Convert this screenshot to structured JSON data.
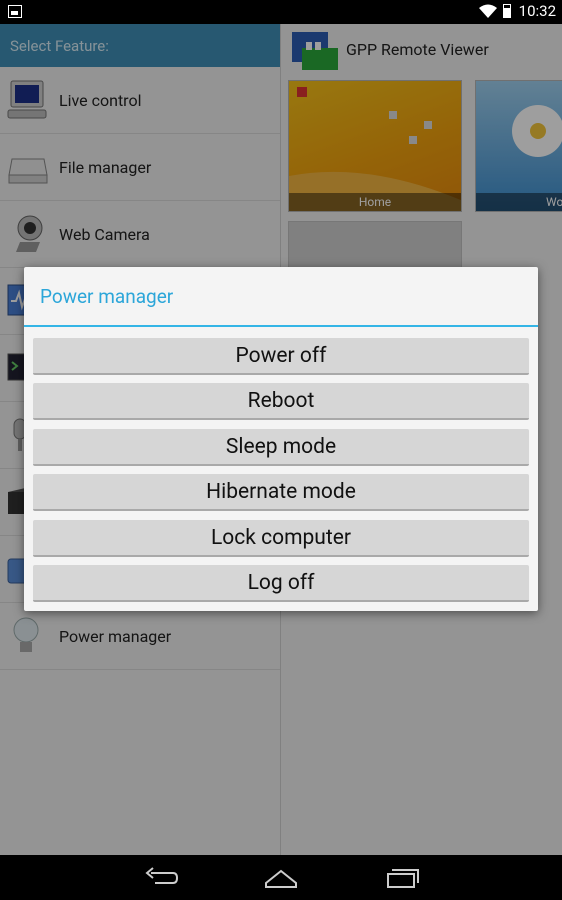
{
  "status_bar": {
    "time": "10:32"
  },
  "left_pane": {
    "header": "Select Feature:",
    "items": [
      {
        "label": "Live control",
        "icon": "monitor-icon"
      },
      {
        "label": "File manager",
        "icon": "drive-icon"
      },
      {
        "label": "Web Camera",
        "icon": "webcam-icon"
      },
      {
        "label": "",
        "icon": "task-manager-icon"
      },
      {
        "label": "",
        "icon": "console-icon"
      },
      {
        "label": "",
        "icon": "microphone-icon"
      },
      {
        "label": "",
        "icon": "media-icon"
      },
      {
        "label": "",
        "icon": "tools-icon"
      },
      {
        "label": "Power manager",
        "icon": "lightbulb-icon"
      }
    ]
  },
  "right_pane": {
    "app_title": "GPP Remote Viewer",
    "thumbnails": [
      {
        "caption": "Home"
      },
      {
        "caption": "Wo"
      }
    ]
  },
  "dialog": {
    "title": "Power manager",
    "buttons": [
      {
        "label": "Power off"
      },
      {
        "label": "Reboot"
      },
      {
        "label": "Sleep mode"
      },
      {
        "label": "Hibernate mode"
      },
      {
        "label": "Lock computer"
      },
      {
        "label": "Log off"
      }
    ]
  },
  "colors": {
    "accent": "#34b5e6",
    "header": "#3f8fb6"
  }
}
